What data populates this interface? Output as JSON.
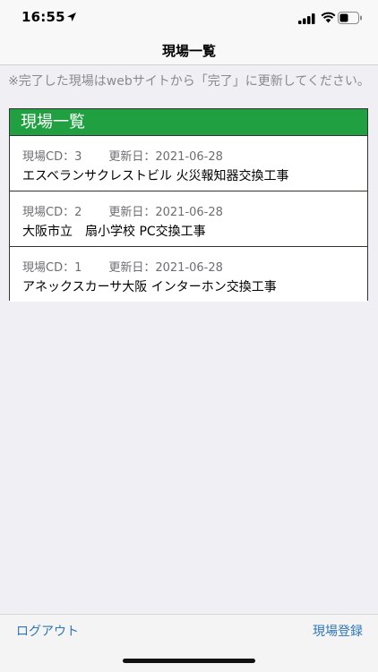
{
  "status_bar": {
    "time": "16:55",
    "icons": [
      "location-arrow-icon",
      "cellular-signal-icon",
      "wifi-icon",
      "battery-icon"
    ]
  },
  "nav": {
    "title": "現場一覧"
  },
  "notice": "※完了した現場はwebサイトから「完了」に更新してください。",
  "panel": {
    "header": "現場一覧",
    "header_color": "#20a040",
    "sites": [
      {
        "cd_text": "現場CD：3",
        "updated_text": "更新日：2021-06-28",
        "name": "エスベランサクレストビル 火災報知器交換工事"
      },
      {
        "cd_text": "現場CD：2",
        "updated_text": "更新日：2021-06-28",
        "name": "大阪市立　扇小学校 PC交換工事"
      },
      {
        "cd_text": "現場CD：1",
        "updated_text": "更新日：2021-06-28",
        "name": "アネックスカーサ大阪 インターホン交換工事"
      }
    ]
  },
  "toolbar": {
    "logout_label": "ログアウト",
    "register_label": "現場登録",
    "link_color": "#2f76b6"
  }
}
